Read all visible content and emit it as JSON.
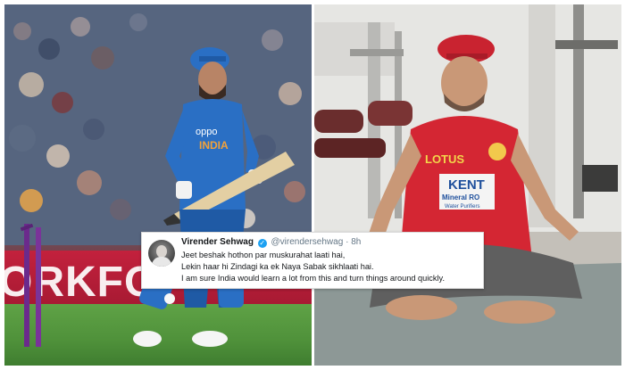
{
  "left_photo": {
    "board_text": "ORKFO",
    "jersey_sponsor": "oppo",
    "jersey_country": "INDIA"
  },
  "right_photo": {
    "jersey_brand": "LOTUS",
    "jersey_sponsor_main": "KENT",
    "jersey_sponsor_sub": "Mineral RO",
    "jersey_sponsor_tagline": "Water Purifiers"
  },
  "tweet": {
    "name": "Virender Sehwag",
    "verified_glyph": "✓",
    "handle": "@virendersehwag",
    "separator": "·",
    "time": "8h",
    "lines": [
      "Jeet beshak hothon par muskurahat laati hai,",
      "Lekin haar hi Zindagi ka ek Naya Sabak sikhlaati hai.",
      "I am sure India would learn a lot from this and turn things around quickly."
    ]
  },
  "colors": {
    "jersey_blue": "#2a6fc4",
    "jersey_red": "#d42633",
    "twitter_blue": "#1da1f2",
    "board_red": "#c3213d",
    "stump_purple": "#6b2a8c"
  }
}
